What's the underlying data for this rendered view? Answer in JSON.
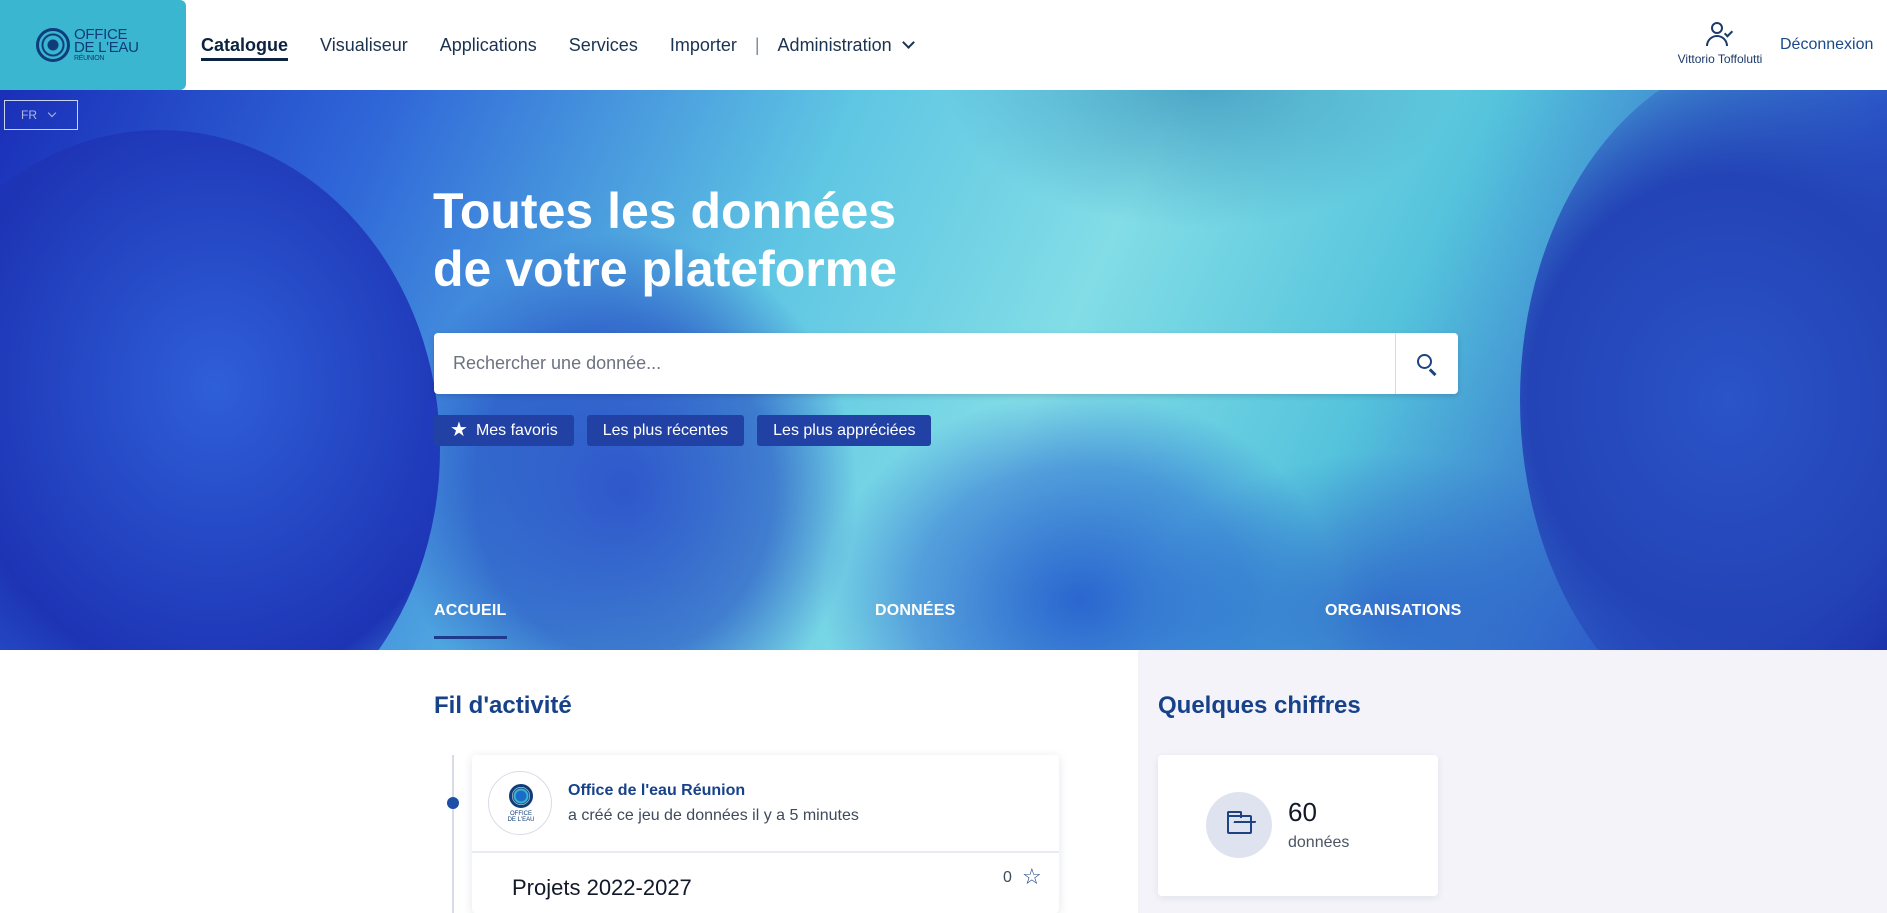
{
  "brand": {
    "logo_line1": "OFFICE",
    "logo_line2": "DE L'EAU",
    "logo_line3": "RÉUNION",
    "color": "#3bb6d1"
  },
  "nav": {
    "items": [
      {
        "label": "Catalogue",
        "active": true
      },
      {
        "label": "Visualiseur"
      },
      {
        "label": "Applications"
      },
      {
        "label": "Services"
      },
      {
        "label": "Importer"
      }
    ],
    "separator": "|",
    "admin_label": "Administration",
    "user_name": "Vittorio Toffolutti",
    "logout_label": "Déconnexion"
  },
  "lang": {
    "selected": "FR"
  },
  "hero": {
    "title_line1": "Toutes les données",
    "title_line2": "de votre plateforme",
    "search_placeholder": "Rechercher une donnée...",
    "chips": [
      "Mes favoris",
      "Les plus récentes",
      "Les plus appréciées"
    ],
    "tabs": [
      "ACCUEIL",
      "DONNÉES",
      "ORGANISATIONS"
    ]
  },
  "activity": {
    "title": "Fil d'activité",
    "items": [
      {
        "org": "Office de l'eau Réunion",
        "action": "a créé ce jeu de données il y a 5 minutes",
        "dataset_title": "Projets 2022-2027",
        "favorites": "0"
      }
    ]
  },
  "stats": {
    "title": "Quelques chiffres",
    "datasets_count": "60",
    "datasets_label": "données"
  },
  "icons": {
    "user": "user-check-icon",
    "search": "search-icon",
    "star": "star-icon",
    "folder": "folder-open-icon"
  },
  "colors": {
    "accent": "#17428a",
    "chip": "#2142a4",
    "logo_bg": "#3bb6d1"
  }
}
